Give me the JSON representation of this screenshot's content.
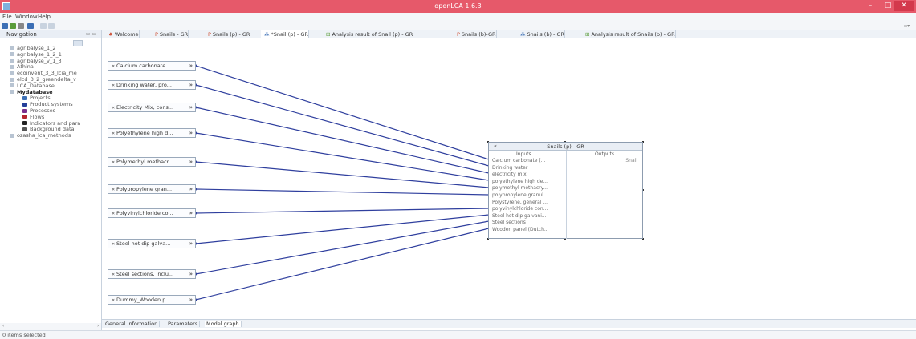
{
  "window": {
    "title": "openLCA 1.6.3"
  },
  "menu": [
    "File",
    "Window",
    "Help"
  ],
  "navigation": {
    "header": "Navigation",
    "items": [
      {
        "label": "agribalyse_1_2",
        "icon": "database-icon",
        "level": 0
      },
      {
        "label": "agribalyse_1_2_1",
        "icon": "database-icon",
        "level": 0
      },
      {
        "label": "agribalyse_v_1_3",
        "icon": "database-icon",
        "level": 0
      },
      {
        "label": "Athina",
        "icon": "database-icon",
        "level": 0
      },
      {
        "label": "ecoinvent_3_3_lcia_me",
        "icon": "database-icon",
        "level": 0
      },
      {
        "label": "elcd_3_2_greendelta_v",
        "icon": "database-icon",
        "level": 0
      },
      {
        "label": "LCA_Database",
        "icon": "database-icon",
        "level": 0
      },
      {
        "label": "Mydatabase",
        "icon": "database-icon",
        "level": 0,
        "bold": true
      },
      {
        "label": "Projects",
        "icon": "folder-icon",
        "color": "#3c6fb5",
        "level": 1
      },
      {
        "label": "Product systems",
        "icon": "folder-icon",
        "color": "#24409a",
        "level": 1
      },
      {
        "label": "Processes",
        "icon": "folder-icon",
        "color": "#7a2f8c",
        "level": 1
      },
      {
        "label": "Flows",
        "icon": "folder-icon",
        "color": "#b3262f",
        "level": 1
      },
      {
        "label": "Indicators and para",
        "icon": "indicator-icon",
        "color": "#222222",
        "level": 1
      },
      {
        "label": "Background data",
        "icon": "background-data-icon",
        "color": "#555555",
        "level": 1
      },
      {
        "label": "ozasha_lca_methods",
        "icon": "database-icon",
        "level": 0
      }
    ]
  },
  "tabs": [
    {
      "label": "Welcome",
      "icon": "home-icon"
    },
    {
      "label": "Snails - GR",
      "icon": "process-icon"
    },
    {
      "label": "Snails (p) - GR",
      "icon": "process-icon"
    },
    {
      "label": "*Snail (p) - GR",
      "icon": "product-system-icon",
      "active": true
    },
    {
      "label": "Analysis result of Snail (p) - GR",
      "icon": "analysis-icon"
    },
    {
      "label": "Snails (b)-GR",
      "icon": "process-icon"
    },
    {
      "label": "Snails (b) - GR",
      "icon": "product-system-icon"
    },
    {
      "label": "Analysis result of Snails (b) - GR",
      "icon": "analysis-icon"
    }
  ],
  "graph": {
    "provider_boxes": [
      "Calcium carbonate ...",
      "Drinking water, pro...",
      "Electricity Mix, cons...",
      "Polyethylene high d...",
      "Polymethyl methacr...",
      "Polypropylene gran...",
      "Polyvinylchloride co...",
      "Steel hot dip galva...",
      "Steel sections, inclu...",
      "Dummy_Wooden p..."
    ],
    "main_process": {
      "title": "Snails (p) - GR",
      "inputs_label": "Inputs",
      "outputs_label": "Outputs",
      "inputs": [
        "Calcium carbonate (...",
        "Drinking water",
        "electricity mix",
        "polyethylene high de...",
        "polymethyl methacry...",
        "polypropylene granul...",
        "Polystyrene, general ...",
        "polyvinylchloride con...",
        "Steel hot dip galvani...",
        "Steel sections",
        "Wooden panel (Dutch..."
      ],
      "outputs": [
        "Snail"
      ]
    }
  },
  "bottom_tabs": [
    "General information",
    "Parameters",
    "Model graph"
  ],
  "status": {
    "text": "0 items selected"
  },
  "colors": {
    "titlebar": "#e6596a",
    "link": "#2f3f9e"
  }
}
